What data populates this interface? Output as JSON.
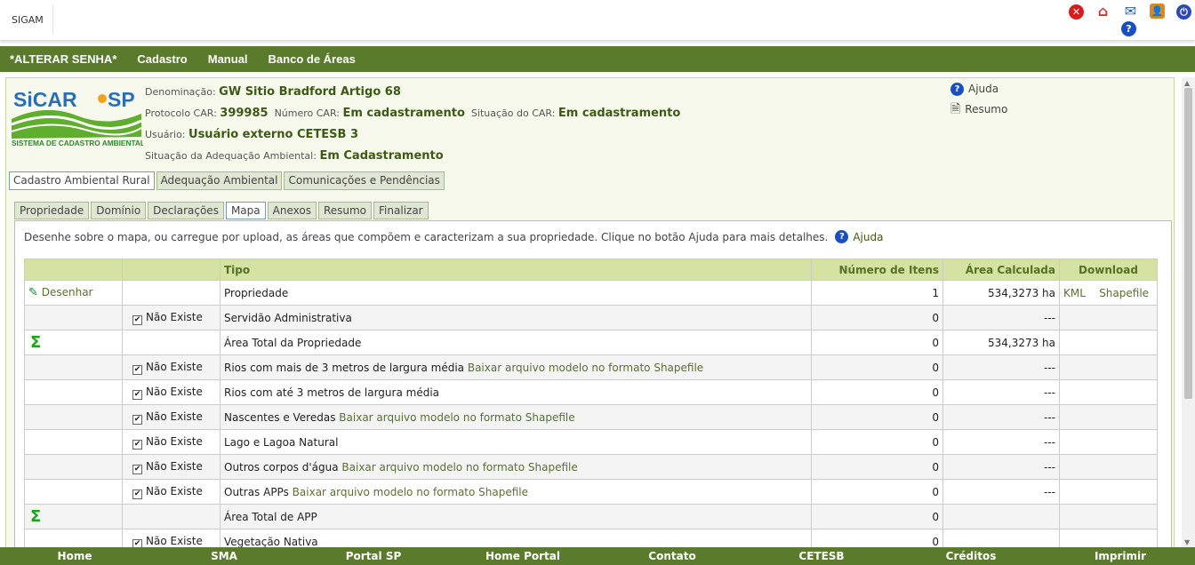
{
  "topbar": {
    "brand": "SIGAM"
  },
  "nav": [
    "*ALTERAR SENHA*",
    "Cadastro",
    "Manual",
    "Banco de Áreas"
  ],
  "logo": {
    "name": "SiCAR SP",
    "tagline": "SISTEMA DE CADASTRO AMBIENTAL RURAL"
  },
  "info": {
    "denominacao_label": "Denominação:",
    "denominacao": "GW Sitio Bradford Artigo 68",
    "protocolo_label": "Protocolo CAR:",
    "protocolo": "399985",
    "numero_label": "Número CAR:",
    "numero": "Em cadastramento",
    "situacao_label": "Situação do CAR:",
    "situacao": "Em cadastramento",
    "usuario_label": "Usuário:",
    "usuario": "Usuário externo CETESB 3",
    "adequacao_label": "Situação da Adequação Ambiental:",
    "adequacao": "Em Cadastramento"
  },
  "rlinks": {
    "ajuda": "Ajuda",
    "resumo": "Resumo"
  },
  "tabs1": [
    "Cadastro Ambiental Rural",
    "Adequação Ambiental",
    "Comunicações e Pendências"
  ],
  "tabs2": [
    "Propriedade",
    "Domínio",
    "Declarações",
    "Mapa",
    "Anexos",
    "Resumo",
    "Finalizar"
  ],
  "desc": {
    "text": "Desenhe sobre o mapa, ou carregue por upload, as áreas que compõem e caracterizam a sua propriedade. Clique no botão Ajuda para mais detalhes.",
    "help": "Ajuda"
  },
  "table": {
    "headers": [
      "",
      "",
      "Tipo",
      "Número de Itens",
      "Área Calculada",
      "Download"
    ],
    "draw_label": "Desenhar",
    "nao_existe": "Não Existe",
    "model_link": "Baixar arquivo modelo no formato Shapefile",
    "kml": "KML",
    "shapefile": "Shapefile",
    "rows": [
      {
        "tipo": "Propriedade",
        "n": "1",
        "area": "534,3273 ha"
      },
      {
        "tipo": "Servidão Administrativa",
        "n": "0",
        "area": "---"
      },
      {
        "tipo": "Área Total da Propriedade",
        "n": "0",
        "area": "534,3273 ha"
      },
      {
        "tipo": "Rios com mais de 3 metros de largura média",
        "n": "0",
        "area": "---"
      },
      {
        "tipo": "Rios com até 3 metros de largura média",
        "n": "0",
        "area": "---"
      },
      {
        "tipo": "Nascentes e Veredas",
        "n": "0",
        "area": "---"
      },
      {
        "tipo": "Lago e Lagoa Natural",
        "n": "0",
        "area": "---"
      },
      {
        "tipo": "Outros corpos d'água",
        "n": "0",
        "area": "---"
      },
      {
        "tipo": "Outras APPs",
        "n": "0",
        "area": "---"
      },
      {
        "tipo": "Área Total de APP",
        "n": "0",
        "area": ""
      },
      {
        "tipo": "Vegetação Nativa",
        "n": "0",
        "area": ""
      }
    ]
  },
  "footer": [
    "Home",
    "SMA",
    "Portal SP",
    "Home Portal",
    "Contato",
    "CETESB",
    "Créditos",
    "Imprimir"
  ],
  "colors": {
    "nav_green": "#5a7b2c",
    "header_green": "#d4e2a4",
    "text_green": "#3c5a14"
  }
}
